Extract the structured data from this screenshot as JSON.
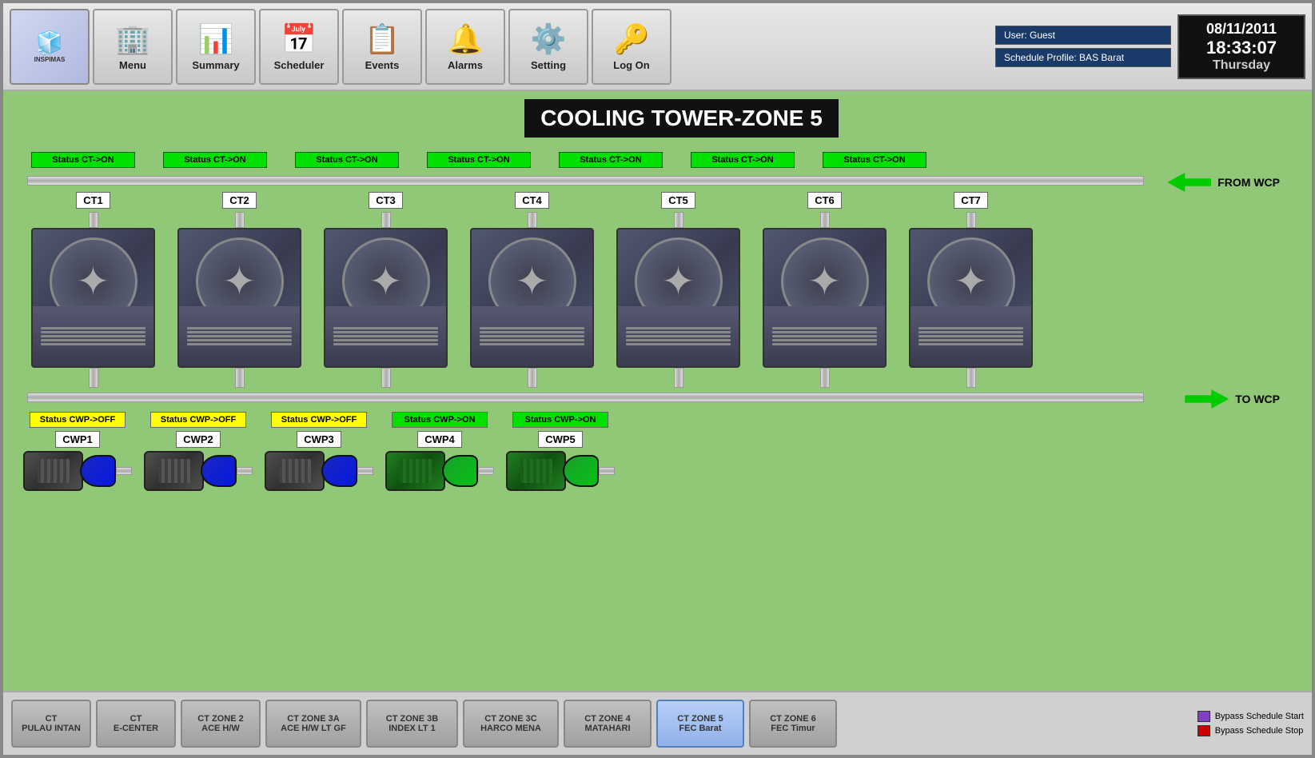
{
  "app": {
    "title": "INSPIMAS"
  },
  "toolbar": {
    "buttons": [
      {
        "label": "Menu",
        "icon": "🏢"
      },
      {
        "label": "Summary",
        "icon": "📊"
      },
      {
        "label": "Scheduler",
        "icon": "📅"
      },
      {
        "label": "Events",
        "icon": "📋"
      },
      {
        "label": "Alarms",
        "icon": "🔔"
      },
      {
        "label": "Setting",
        "icon": "⚙️"
      },
      {
        "label": "Log On",
        "icon": "🔑"
      }
    ],
    "user": "User: Guest",
    "schedule_profile": "Schedule Profile: BAS Barat",
    "date": "08/11/2011",
    "time": "18:33:07",
    "day": "Thursday"
  },
  "page": {
    "title": "COOLING TOWER-ZONE 5"
  },
  "cooling_towers": [
    {
      "id": "CT1",
      "status": "Status CT->ON"
    },
    {
      "id": "CT2",
      "status": "Status CT->ON"
    },
    {
      "id": "CT3",
      "status": "Status CT->ON"
    },
    {
      "id": "CT4",
      "status": "Status CT->ON"
    },
    {
      "id": "CT5",
      "status": "Status CT->ON"
    },
    {
      "id": "CT6",
      "status": "Status CT->ON"
    },
    {
      "id": "CT7",
      "status": "Status CT->ON"
    }
  ],
  "from_wcp": "FROM WCP",
  "to_wcp": "TO WCP",
  "cwp_pumps": [
    {
      "id": "CWP1",
      "status": "Status CWP->OFF",
      "on": false
    },
    {
      "id": "CWP2",
      "status": "Status CWP->OFF",
      "on": false
    },
    {
      "id": "CWP3",
      "status": "Status CWP->OFF",
      "on": false
    },
    {
      "id": "CWP4",
      "status": "Status CWP->ON",
      "on": true
    },
    {
      "id": "CWP5",
      "status": "Status CWP->ON",
      "on": true
    }
  ],
  "zone_tabs": [
    {
      "label": "CT\nPULAU INTAN",
      "active": false
    },
    {
      "label": "CT\nE-CENTER",
      "active": false
    },
    {
      "label": "CT ZONE 2\nACE H/W",
      "active": false
    },
    {
      "label": "CT ZONE 3A\nACE H/W LT GF",
      "active": false
    },
    {
      "label": "CT ZONE 3B\nINDEX LT 1",
      "active": false
    },
    {
      "label": "CT ZONE 3C\nHARCO MENA",
      "active": false
    },
    {
      "label": "CT ZONE 4\nMATAHARI",
      "active": false
    },
    {
      "label": "CT ZONE 5\nFEC Barat",
      "active": true
    },
    {
      "label": "CT ZONE 6\nFEC Timur",
      "active": false
    }
  ],
  "bypass_legend": {
    "start_label": "Bypass Schedule Start",
    "stop_label": "Bypass Schedule Stop",
    "start_color": "#8040c0",
    "stop_color": "#cc0000"
  }
}
